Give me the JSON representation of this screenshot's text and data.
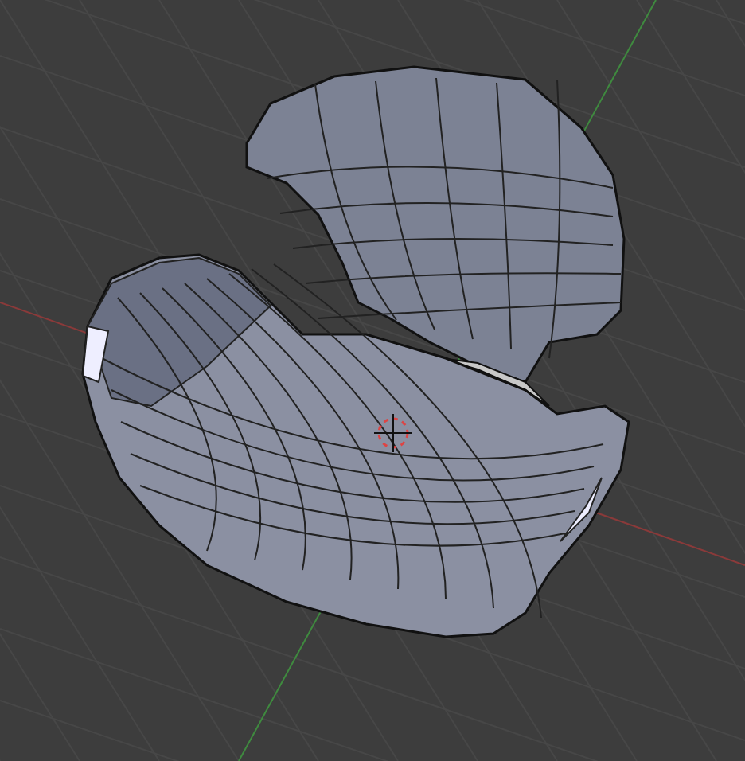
{
  "viewport": {
    "grid": true,
    "cursor": true
  }
}
